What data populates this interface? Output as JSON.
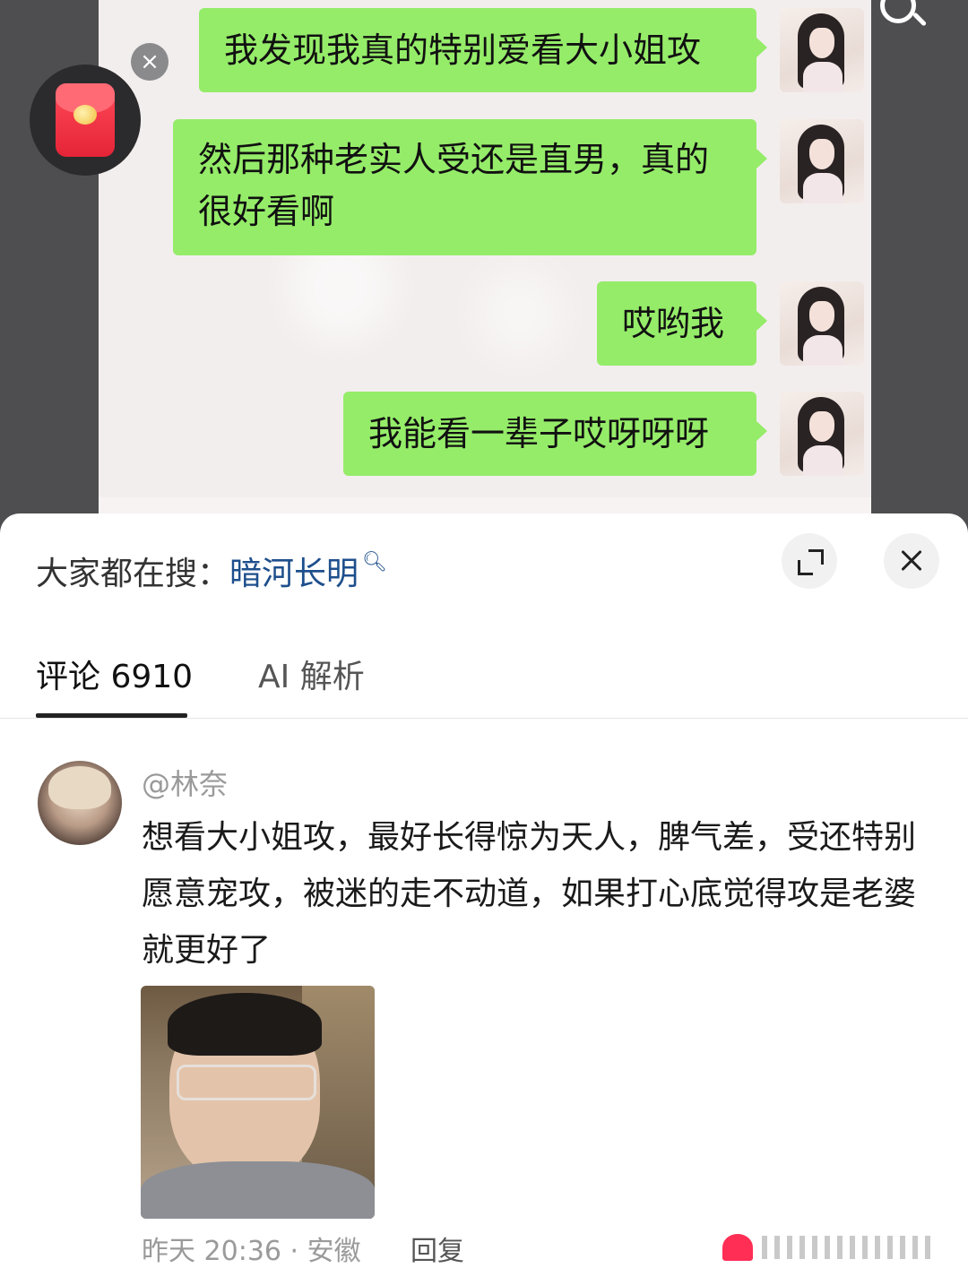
{
  "chat": {
    "messages": [
      {
        "text": "我发现我真的特别爱看大小姐攻"
      },
      {
        "text": "然后那种老实人受还是直男，真的很好看啊"
      },
      {
        "text": "哎哟我"
      },
      {
        "text": "我能看一辈子哎呀呀呀"
      }
    ],
    "avatar_icon": "girl-avatar-icon"
  },
  "floating": {
    "redpacket_icon": "red-packet-icon",
    "close_glyph": "×"
  },
  "sheet": {
    "trending_prefix": "大家都在搜：",
    "trending_link": "暗河长明",
    "trending_icon": "search-icon",
    "expand_icon": "expand-icon",
    "close_icon": "close-icon",
    "tabs": [
      {
        "label": "评论 6910",
        "active": true
      },
      {
        "label": "AI 解析",
        "active": false
      }
    ]
  },
  "comment": {
    "username": "@林奈",
    "text": "想看大小姐攻，最好长得惊为天人，脾气差，受还特别愿意宠攻，被迷的走不动道，如果打心底觉得攻是老婆就更好了",
    "meta": "昨天 20:36 · 安徽",
    "reply_label": "回复",
    "like_color": "#ff2e55"
  }
}
